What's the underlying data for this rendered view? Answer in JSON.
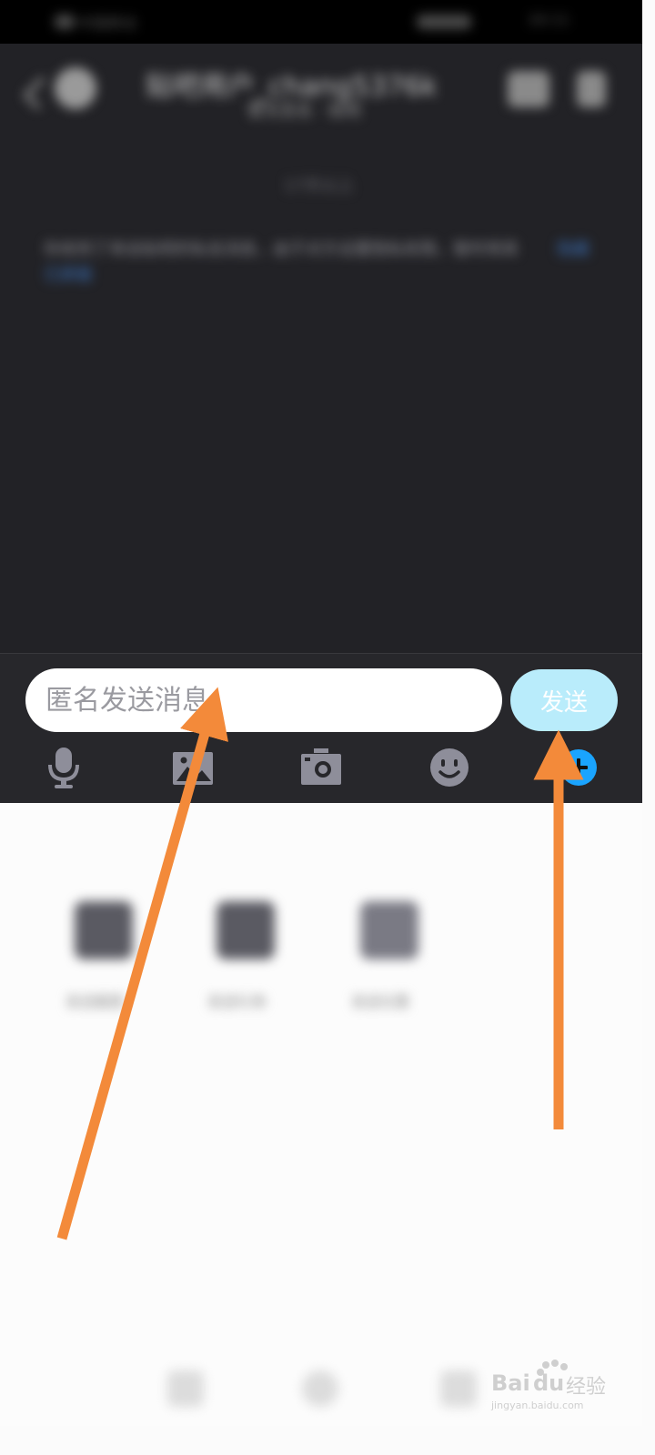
{
  "status_bar": {
    "carrier": "中国移动",
    "time": "16:11"
  },
  "header": {
    "title": "贴吧用户_chang5376k",
    "subtitle": "暂无签名 · 贴吧",
    "back_icon": "chevron-left-icon",
    "avatar_icon": "avatar-icon",
    "profile_icon": "profile-icon",
    "menu_icon": "menu-icon"
  },
  "chat": {
    "timestamp": "17天以上",
    "notice_line1": "你收到了来自贴吧的私信消息，由于对方设置隐私权限，暂时将其",
    "notice_link": "隐藏",
    "notice_line2": "已屏蔽"
  },
  "input": {
    "placeholder": "匿名发送消息",
    "send_label": "发送"
  },
  "toolbar": {
    "icons": [
      "microphone-icon",
      "image-icon",
      "camera-icon",
      "emoji-icon",
      "plus-icon"
    ],
    "accent": "#1aa4ff"
  },
  "panel": {
    "apps": [
      {
        "label": "发送截图"
      },
      {
        "label": "发送礼物"
      },
      {
        "label": "发送位置"
      }
    ]
  },
  "watermark": {
    "brand": "Bai",
    "brand2": "du",
    "sub": "经验",
    "url": "jingyan.baidu.com"
  },
  "colors": {
    "arrow": "#f38a3a",
    "send_button": "#b9ecfb",
    "chat_bg": "#222226"
  }
}
